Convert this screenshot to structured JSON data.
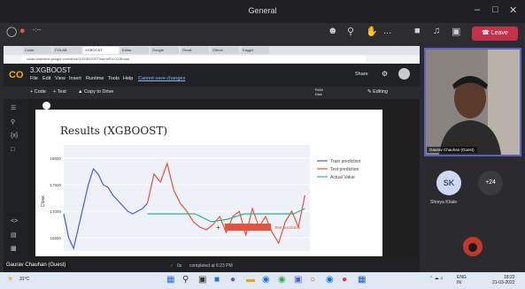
{
  "teams": {
    "title": "General",
    "toolbar": {
      "time": "-:--",
      "leave_label": "Leave",
      "more": "..."
    },
    "participants": {
      "cam_name": "Gaurav Chauhan (Guest)",
      "sk_initials": "SK",
      "more_count": "+24",
      "sk_name": "Shreya Khale"
    }
  },
  "browser": {
    "tabs": [
      "Colab",
      "COLAB",
      "XGBOOST",
      "Editor",
      "Google",
      "Gmail",
      "Github",
      "Kaggle"
    ],
    "url": "colab.research.google.com/drive/1/XGBOOST#scrollTo=XGBoost"
  },
  "colab": {
    "notebook_title": "3.XGBOOST",
    "menu": [
      "File",
      "Edit",
      "View",
      "Insert",
      "Runtime",
      "Tools",
      "Help",
      "Cannot save changes"
    ],
    "toolbar": {
      "code": "+ Code",
      "text": "+ Text",
      "copy": "Copy to Drive",
      "share": "Share",
      "ram": "RAM",
      "disk": "Disk",
      "editing": "Editing"
    },
    "status": "completed at 6:23 PM",
    "status_prefix": "0s"
  },
  "caption": "Gaurav Chauhan (Guest)",
  "taskbar": {
    "weather": "31°C",
    "lang": "ENG",
    "region": "IN",
    "time": "18:22",
    "date": "21-03-2022"
  },
  "chart_data": {
    "type": "line",
    "title": "Results (XGBOOST)",
    "ylabel": "Close",
    "yticks": [
      "18000",
      "17500",
      "17000",
      "16500"
    ],
    "ylim": [
      16250,
      18250
    ],
    "legend_position": "right",
    "series": [
      {
        "name": "Train prediction",
        "color": "#4a5bd4",
        "x": [
          0,
          3,
          6,
          9,
          12,
          15,
          18,
          21,
          24,
          27,
          30,
          33,
          36,
          39,
          42,
          45,
          48,
          51
        ],
        "values": [
          16950,
          16500,
          16300,
          16700,
          17100,
          17500,
          17800,
          17700,
          17500,
          17450,
          17300,
          17200,
          17100,
          17000,
          16950,
          17000,
          17050,
          17150
        ]
      },
      {
        "name": "Test prediction",
        "color": "#e5533d",
        "x": [
          51,
          55,
          59,
          63,
          67,
          71,
          75,
          79,
          83,
          87,
          91,
          95,
          99,
          103,
          107,
          111,
          115,
          119,
          123,
          127,
          131,
          135,
          139,
          143,
          147
        ],
        "values": [
          17150,
          17700,
          17550,
          17900,
          17400,
          17150,
          17000,
          16800,
          16700,
          16650,
          16750,
          16900,
          16600,
          16900,
          17000,
          16550,
          17050,
          16700,
          16900,
          16600,
          16400,
          16800,
          17000,
          16700,
          17300
        ]
      },
      {
        "name": "Actual Value",
        "color": "#2ab58a",
        "x": [
          51,
          60,
          70,
          80,
          90,
          100,
          110,
          120,
          130,
          140,
          147
        ],
        "values": [
          16950,
          16950,
          16950,
          16950,
          16800,
          16850,
          16950,
          16950,
          16950,
          16950,
          17050
        ]
      }
    ],
    "hover_annotation": "Test prediction"
  }
}
